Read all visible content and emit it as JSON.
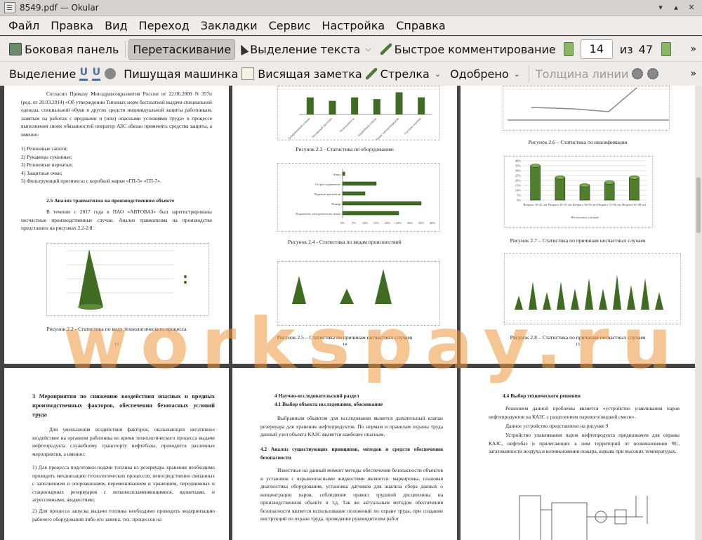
{
  "window": {
    "title": "8549.pdf  — Okular",
    "controls": [
      "▾",
      "▴",
      "✕"
    ]
  },
  "menu": [
    "Файл",
    "Правка",
    "Вид",
    "Переход",
    "Закладки",
    "Сервис",
    "Настройка",
    "Справка"
  ],
  "toolbar1": {
    "sidebar": "Боковая панель",
    "drag": "Перетаскивание",
    "text_select": "Выделение текста",
    "quick_comment": "Быстрое комментирование",
    "page_current": "14",
    "page_of": "из",
    "page_total": "47"
  },
  "toolbar2": {
    "highlight": "Выделение",
    "typewriter": "Пишущая машинка",
    "popup_note": "Висящая заметка",
    "arrow": "Стрелка",
    "stamp": "Одобрено",
    "line_width": "Толщина линии"
  },
  "watermark": "workspay.ru",
  "pages": {
    "p1": {
      "para1": "Согласно Приказу Минздравсоцразвития России от 22.06.2009 N 357н (ред. от 20.03.2014) «Об утверждении Типовых норм бесплатной выдачи специальной одежды, специальной обуви и других средств индивидуальной защиты работникам, занятым на работах с вредными и (или) опасными условиями труда» в процессе выполнения своих обязанностей оператор АЗС обязан применять средства защиты, а именно:",
      "list": [
        "1)     Резиновые сапоги;",
        "2)     Рукавицы суконные;",
        "3)     Резиновые перчатки;",
        "4)     Защитные очки;",
        "5)     Фильтрующий противогаз с коробкой марки «ГП-5» «ГП-7»."
      ],
      "heading": "2.5 Анализ травматизма на производственном объекте",
      "para2": "В течение с 2017 года в ПАО «АВТОВАЗ» был зарегистрированы несчастные производственные случаи. Анализ травматизма на производстве представлен на рисунках 2.2-2.8.",
      "caption": "Рисунок 2.2 - Статистика по виду технологического процесса",
      "num": "13"
    },
    "p2": {
      "cap1": "Рисунок 2.3 - Статистика по оборудованию",
      "cap2": "Рисунок 2.4 - Статистика по видам происшествий",
      "cap3": "Рисунок 2.5 – Статистика по причинам несчастных случаев",
      "num": "14"
    },
    "p3": {
      "cap1": "Рисунок 2.6 – Статистика по квалификации",
      "cap2": "Рисунок 2.7 – Статистика по причинам несчастных случаев",
      "cap3": "Рисунок 2.8 – Статистика по причинам несчастных случаев",
      "num": "15"
    },
    "p4": {
      "heading": "3 Мероприятия по снижению воздействия опасных и вредных производственных факторов, обеспечения безопасных условий труда",
      "para1": "Для уменьшения воздействия факторов, оказывающих негативное воздействие на организм работника во время технологического процесса выдачи нефтепродукта служебному транспорту нефтебазы, проводится различные мероприятия, а именно:",
      "para2": "1) Для процесса подготовки подачи топлива из резервуара хранения необходимо проводить механизацию технологических процессов, непосредственно связанных с заполнением и опорожнением, перемешиванием и хранением, передвижных и стационарных резервуаров с легковоспламеняющимися, ядовитыми, и агрессивными, жидкостями;",
      "para3": "2) Для процесса запуска выдачи топлива необходимо проводить модернизацию рабочего оборудования либо его замена, тех. процессов на"
    },
    "p5": {
      "heading": "4 Научно-исследовательский раздел",
      "sub1": "4.1 Выбор объекта исследования, обоснование",
      "para1": "Выбранным объектом для исследования является дыхательный клапан резервуара для хранения нефтепродуктов. По нормам и правилам охраны труда данный узел объекта КАЗС является наиболее опасным.",
      "sub2": "4.2 Анализ существующих принципов, методов и средств обеспечения безопасности",
      "para2": "Известные на данный момент методы обеспечения безопасности объектов и установок с взрывоопасными жидкостями являются: маркировка, плановая диагностика оборудования, установка датчиков для анализа сбора данных о концентрации паров, соблюдение правил трудовой дисциплины на производственном объекте и т.д. Так же актуальным методом обеспечения безопасности является использование положений по охране труда, при создании инструкций по охране труда, проведение руководителем работ"
    },
    "p6": {
      "heading": "4.4 Выбор технического решения",
      "para1": "Решением данной проблемы является «устройство улавливания паров нефтепродуктов на КАЗС с разделением парового/жидкой смеси».",
      "para2": "Данное устройство представлено на рисунке 9",
      "para3": "Устройство улавливания паров нефтепродукта предназначен для охраны КАЗС, нефтебаз и прилегающих к ним территорий от возникновения ЧС, загазованности воздуха и возникновения пожара, взрыва при высоких температурах."
    }
  },
  "chart_data": [
    {
      "type": "bar",
      "title": "",
      "categories": [
        "Дозированный клапан",
        "Топливный пистолет",
        "Огнетушитель",
        "Аварийный клапан",
        "Линия электропередачи",
        "Система откачки"
      ],
      "values": [
        0.1,
        0.08,
        0.1,
        0.09,
        0.13,
        0.1
      ]
    },
    {
      "type": "bar",
      "orientation": "horizontal",
      "categories": [
        "Отказ",
        "Острое отравление",
        "Падение предметов",
        "Пожар",
        "Поражение электрическим током"
      ],
      "values": [
        1,
        15,
        10,
        35,
        25
      ],
      "xlim": [
        0,
        40
      ]
    },
    {
      "type": "bar",
      "categories": [
        "Возраст 18-25 лет",
        "Возраст 26-35 лет",
        "Возраст 36-50 лет",
        "Возраст 51-60 лет",
        "Возраст 61-80 лет"
      ],
      "values": [
        35,
        23,
        15,
        18,
        23
      ],
      "ylim": [
        0,
        40
      ],
      "series_name": "Несчастных случаев"
    }
  ]
}
